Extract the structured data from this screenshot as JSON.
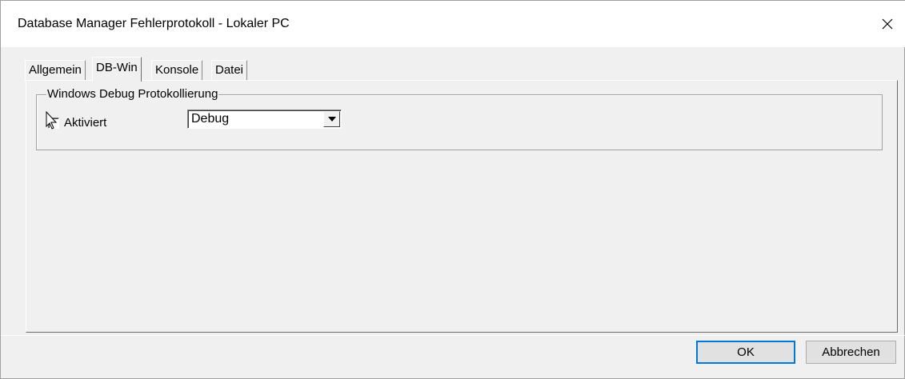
{
  "window": {
    "title": "Database Manager Fehlerprotokoll - Lokaler PC",
    "close_icon": "close-icon"
  },
  "tabs": [
    {
      "label": "Allgemein",
      "active": false
    },
    {
      "label": "DB-Win",
      "active": true
    },
    {
      "label": "Konsole",
      "active": false
    },
    {
      "label": "Datei",
      "active": false
    }
  ],
  "panel": {
    "group_title": "Windows Debug Protokollierung",
    "checkbox": {
      "label": "Aktiviert",
      "checked": false
    },
    "level_select": {
      "value": "Debug",
      "icon": "chevron-down-icon"
    }
  },
  "buttons": {
    "ok_label": "OK",
    "cancel_label": "Abbrechen"
  },
  "colors": {
    "background": "#f0f0f0",
    "accent": "#0078d7"
  }
}
